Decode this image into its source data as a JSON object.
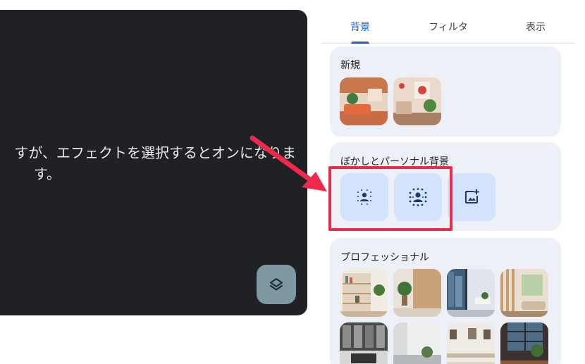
{
  "preview": {
    "message_line1": "すが、エフェクトを選択するとオンになりま",
    "message_line2": "す。"
  },
  "tabs": [
    {
      "label": "背景",
      "active": true
    },
    {
      "label": "フィルタ",
      "active": false
    },
    {
      "label": "表示",
      "active": false
    }
  ],
  "sections": {
    "new": {
      "title": "新規"
    },
    "blur": {
      "title": "ぼかしとパーソナル背景"
    },
    "professional": {
      "title": "プロフェッショナル"
    }
  },
  "colors": {
    "accent": "#1a5fd1",
    "highlight": "#ee2a4a",
    "preview_bg": "#202124",
    "card_bg": "#eef0f7",
    "effect_tile_bg": "#d3e3fd"
  },
  "icons": [
    "layers-icon",
    "blur-slight-icon",
    "blur-full-icon",
    "add-image-icon",
    "arrow-annotation"
  ]
}
